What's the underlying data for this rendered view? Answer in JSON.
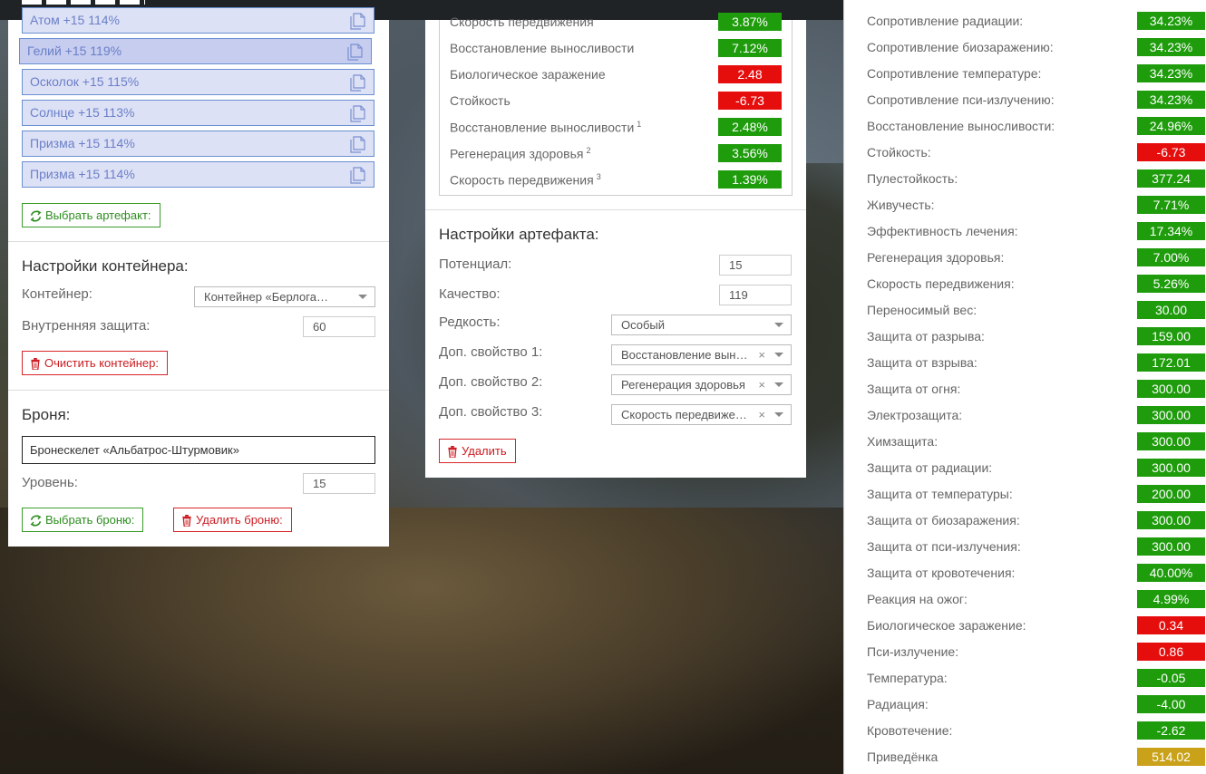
{
  "left_panel": {
    "artifacts": [
      {
        "label": "Атом +15 114%"
      },
      {
        "label": "Гелий +15 119%"
      },
      {
        "label": "Осколок +15 115%"
      },
      {
        "label": "Солнце +15 113%"
      },
      {
        "label": "Призма +15 114%"
      },
      {
        "label": "Призма +15 114%"
      }
    ],
    "select_artifact_label": "Выбрать артефакт:",
    "container_title": "Настройки контейнера:",
    "container_label": "Контейнер:",
    "container_value": "Контейнер «Берлога…",
    "inner_protection_label": "Внутренняя защита:",
    "inner_protection_value": "60",
    "clear_container_label": "Очистить контейнер:",
    "armor_title": "Броня:",
    "armor_value": "Бронескелет «Альбатрос-Штурмовик»",
    "level_label": "Уровень:",
    "level_value": "15",
    "select_armor_label": "Выбрать броню:",
    "delete_armor_label": "Удалить броню:"
  },
  "mid_panel": {
    "stats": [
      {
        "label": "Скорость передвижения",
        "sup": "",
        "value": "3.87%",
        "status": "green"
      },
      {
        "label": "Восстановление выносливости",
        "sup": "",
        "value": "7.12%",
        "status": "green"
      },
      {
        "label": "Биологическое заражение",
        "sup": "",
        "value": "2.48",
        "status": "red"
      },
      {
        "label": "Стойкость",
        "sup": "",
        "value": "-6.73",
        "status": "red"
      },
      {
        "label": "Восстановление выносливости",
        "sup": "1",
        "value": "2.48%",
        "status": "green"
      },
      {
        "label": "Регенерация здоровья",
        "sup": "2",
        "value": "3.56%",
        "status": "green"
      },
      {
        "label": "Скорость передвижения",
        "sup": "3",
        "value": "1.39%",
        "status": "green"
      }
    ],
    "artifact_settings_title": "Настройки артефакта:",
    "potential_label": "Потенциал:",
    "potential_value": "15",
    "quality_label": "Качество:",
    "quality_value": "119",
    "rarity_label": "Редкость:",
    "rarity_value": "Особый",
    "extra1_label": "Доп. свойство 1:",
    "extra1_value": "Восстановление выносливости",
    "extra2_label": "Доп. свойство 2:",
    "extra2_value": "Регенерация здоровья",
    "extra3_label": "Доп. свойство 3:",
    "extra3_value": "Скорость передвижения",
    "clear_glyph": "×",
    "delete_label": "Удалить"
  },
  "right_panel": {
    "stats": [
      {
        "label": "Сопротивление радиации:",
        "value": "34.23%",
        "status": "green"
      },
      {
        "label": "Сопротивление биозаражению:",
        "value": "34.23%",
        "status": "green"
      },
      {
        "label": "Сопротивление температуре:",
        "value": "34.23%",
        "status": "green"
      },
      {
        "label": "Сопротивление пси-излучению:",
        "value": "34.23%",
        "status": "green"
      },
      {
        "label": "Восстановление выносливости:",
        "value": "24.96%",
        "status": "green"
      },
      {
        "label": "Стойкость:",
        "value": "-6.73",
        "status": "red"
      },
      {
        "label": "Пулестойкость:",
        "value": "377.24",
        "status": "green"
      },
      {
        "label": "Живучесть:",
        "value": "7.71%",
        "status": "green"
      },
      {
        "label": "Эффективность лечения:",
        "value": "17.34%",
        "status": "green"
      },
      {
        "label": "Регенерация здоровья:",
        "value": "7.00%",
        "status": "green"
      },
      {
        "label": "Скорость передвижения:",
        "value": "5.26%",
        "status": "green"
      },
      {
        "label": "Переносимый вес:",
        "value": "30.00",
        "status": "green"
      },
      {
        "label": "Защита от разрыва:",
        "value": "159.00",
        "status": "green"
      },
      {
        "label": "Защита от взрыва:",
        "value": "172.01",
        "status": "green"
      },
      {
        "label": "Защита от огня:",
        "value": "300.00",
        "status": "green"
      },
      {
        "label": "Электрозащита:",
        "value": "300.00",
        "status": "green"
      },
      {
        "label": "Химзащита:",
        "value": "300.00",
        "status": "green"
      },
      {
        "label": "Защита от радиации:",
        "value": "300.00",
        "status": "green"
      },
      {
        "label": "Защита от температуры:",
        "value": "200.00",
        "status": "green"
      },
      {
        "label": "Защита от биозаражения:",
        "value": "300.00",
        "status": "green"
      },
      {
        "label": "Защита от пси-излучения:",
        "value": "300.00",
        "status": "green"
      },
      {
        "label": "Защита от кровотечения:",
        "value": "40.00%",
        "status": "green"
      },
      {
        "label": "Реакция на ожог:",
        "value": "4.99%",
        "status": "green"
      },
      {
        "label": "Биологическое заражение:",
        "value": "0.34",
        "status": "red"
      },
      {
        "label": "Пси-излучение:",
        "value": "0.86",
        "status": "red"
      },
      {
        "label": "Температура:",
        "value": "-0.05",
        "status": "green"
      },
      {
        "label": "Радиация:",
        "value": "-4.00",
        "status": "green"
      },
      {
        "label": "Кровотечение:",
        "value": "-2.62",
        "status": "green"
      },
      {
        "label": "Приведёнка",
        "value": "514.02",
        "status": "gold"
      }
    ]
  },
  "colors": {
    "positive": "#1e9c0c",
    "negative": "#e60d0d",
    "summary": "#c9a21a",
    "artifact_bg": "#dde1f6",
    "artifact_border": "#6a8fd0"
  },
  "icons": {
    "copy": "copy-icon",
    "refresh": "refresh-icon",
    "trash": "trash-icon",
    "dropdown": "chevron-down-icon"
  }
}
